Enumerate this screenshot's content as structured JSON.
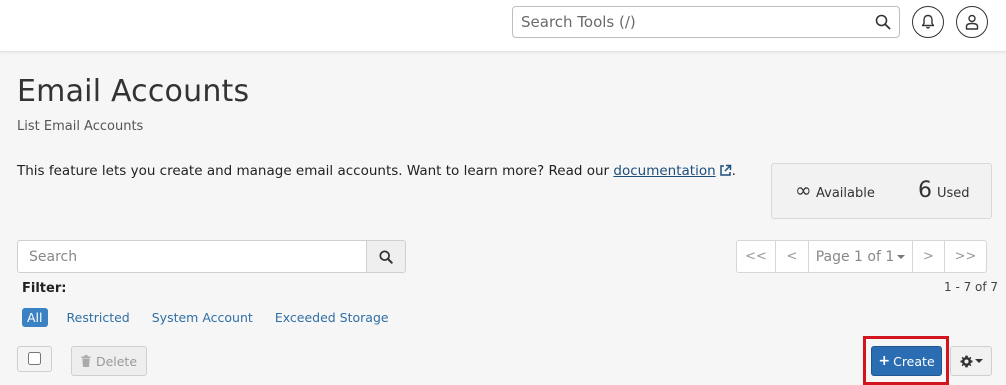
{
  "topbar": {
    "search_placeholder": "Search Tools (/)",
    "icons": [
      "search-icon",
      "bell-icon",
      "user-icon"
    ]
  },
  "header": {
    "title": "Email Accounts",
    "subtitle": "List Email Accounts"
  },
  "intro": {
    "text": "This feature lets you create and manage email accounts. Want to learn more? Read our ",
    "link_text": "documentation",
    "suffix": "."
  },
  "quota": {
    "available_symbol": "∞",
    "available_label": "Available",
    "used_count": "6",
    "used_label": "Used"
  },
  "list_search": {
    "placeholder": "Search"
  },
  "pagination": {
    "first": "<<",
    "prev": "<",
    "page_label": "Page 1 of 1",
    "next": ">",
    "last": ">>"
  },
  "filter": {
    "label": "Filter:",
    "options": [
      "All",
      "Restricted",
      "System Account",
      "Exceeded Storage"
    ],
    "active": "All"
  },
  "results_count": "1 - 7 of 7",
  "actions": {
    "delete_label": "Delete",
    "create_label": "Create"
  },
  "colors": {
    "primary": "#2a6db2",
    "highlight": "#d2141c",
    "link": "#1d4f7c",
    "filter_active": "#3b82c4"
  }
}
